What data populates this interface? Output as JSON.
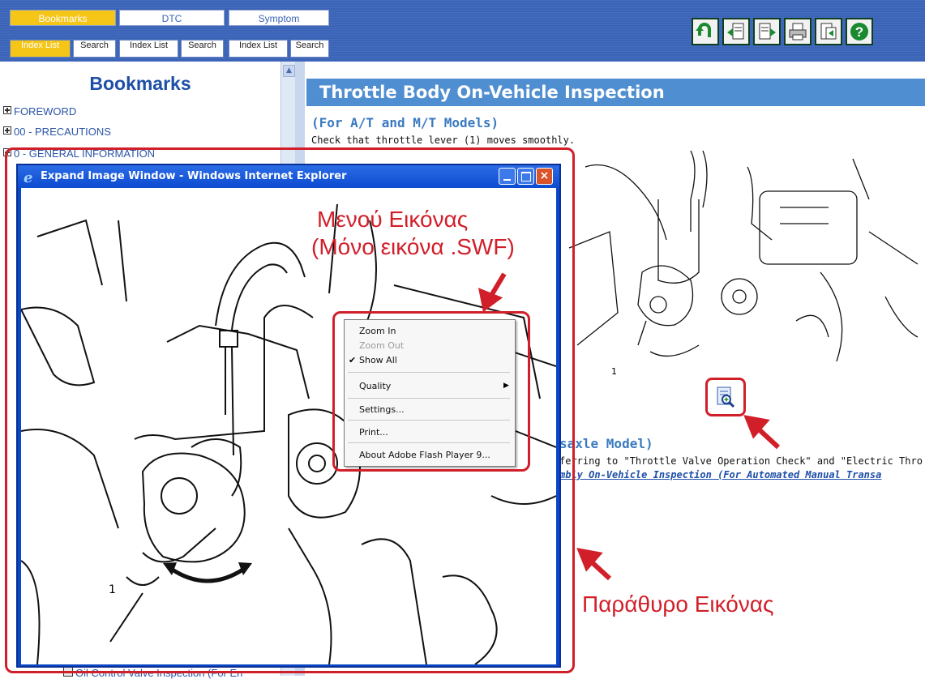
{
  "top_tabs": [
    "Bookmarks",
    "DTC",
    "Symptom"
  ],
  "sub_tabs": [
    "Index List",
    "Search",
    "Index List",
    "Search",
    "Index List",
    "Search"
  ],
  "toolbar_icons": [
    "back-icon",
    "previous-page-icon",
    "next-page-icon",
    "print-icon",
    "export-icon",
    "help-icon"
  ],
  "bookmarks": {
    "title": "Bookmarks",
    "items": [
      "FOREWORD",
      "00 - PRECAUTIONS",
      "0 - GENERAL INFORMATION"
    ],
    "footer_item": "Oil Control Valve Inspection (For En"
  },
  "content": {
    "title": "Throttle Body On-Vehicle Inspection",
    "subtitle": "(For A/T and M/T Models)",
    "instruction": "Check that throttle lever (1) moves smoothly.",
    "subtitle2": "saxle Model)",
    "text2": "ferring to \"Throttle Valve Operation Check\" and \"Electric Thro",
    "link2": "mbly On-Vehicle Inspection (For Automated Manual Transa",
    "figure_label": "1"
  },
  "popup": {
    "title": "Expand Image Window - Windows Internet Explorer",
    "figure_label": "1"
  },
  "context_menu": {
    "items": [
      "Zoom In",
      "Zoom Out",
      "Show All",
      "Quality",
      "Settings...",
      "Print...",
      "About Adobe Flash Player 9..."
    ]
  },
  "annotations": {
    "menu_label_line1": "Μενού Εικόνας",
    "menu_label_line2": "(Μόνο εικόνα .SWF)",
    "window_label": "Παράθυρο Εικόνας"
  },
  "colors": {
    "accent": "#3b64b8",
    "active_tab": "#f5c518",
    "annotation": "#d11f2a",
    "title_bar": "#4f8ed0"
  }
}
